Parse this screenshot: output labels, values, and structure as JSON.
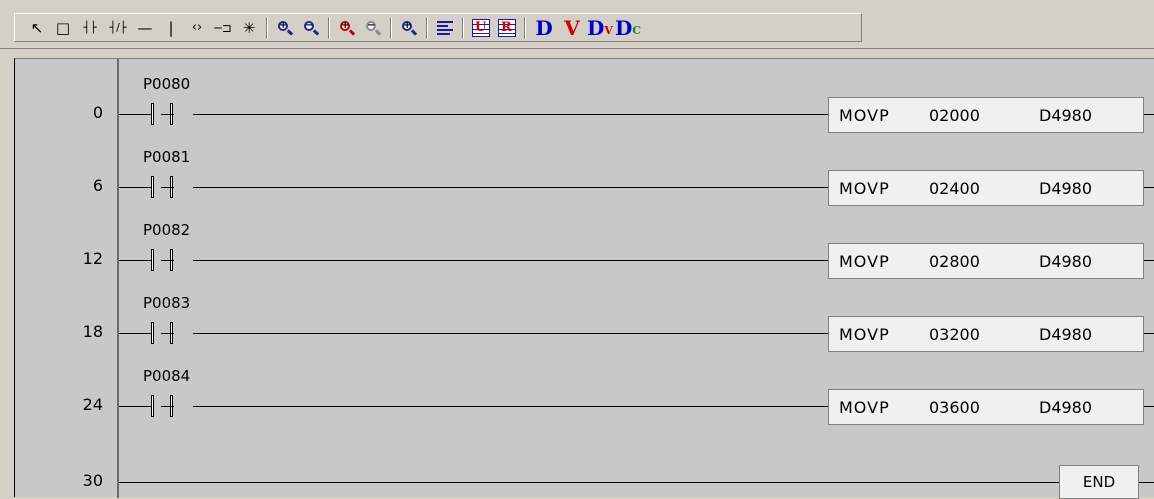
{
  "toolbar": {
    "buttons": [
      {
        "name": "select-arrow-icon",
        "glyph": "↖"
      },
      {
        "name": "rectangle-icon",
        "glyph": "□"
      },
      {
        "name": "no-contact-icon",
        "glyph": "┤├"
      },
      {
        "name": "nc-contact-icon",
        "glyph": "┤/├"
      },
      {
        "name": "horizontal-line-icon",
        "glyph": "—"
      },
      {
        "name": "vertical-line-icon",
        "glyph": "|"
      },
      {
        "name": "coil-icon",
        "glyph": "‹›"
      },
      {
        "name": "function-icon",
        "glyph": "─⊐"
      },
      {
        "name": "invert-icon",
        "glyph": "✳"
      }
    ],
    "dv_labels": {
      "d": "D",
      "v": "V",
      "dv": "D",
      "dv_sub": "V",
      "dc": "D",
      "dc_sub": "C"
    },
    "ur_labels": {
      "u": "U",
      "r": "R"
    }
  },
  "ladder": {
    "rungs": [
      {
        "step": "0",
        "contact": "P0080",
        "op": "MOVP",
        "src": "02000",
        "dst": "D4980"
      },
      {
        "step": "6",
        "contact": "P0081",
        "op": "MOVP",
        "src": "02400",
        "dst": "D4980"
      },
      {
        "step": "12",
        "contact": "P0082",
        "op": "MOVP",
        "src": "02800",
        "dst": "D4980"
      },
      {
        "step": "18",
        "contact": "P0083",
        "op": "MOVP",
        "src": "03200",
        "dst": "D4980"
      },
      {
        "step": "24",
        "contact": "P0084",
        "op": "MOVP",
        "src": "03600",
        "dst": "D4980"
      }
    ],
    "end_rung": {
      "step": "30",
      "label": "END"
    }
  },
  "colors": {
    "background": "#c8c8c8",
    "toolbar": "#d4d0c8",
    "blue": "#0000cc",
    "red": "#d00000"
  }
}
